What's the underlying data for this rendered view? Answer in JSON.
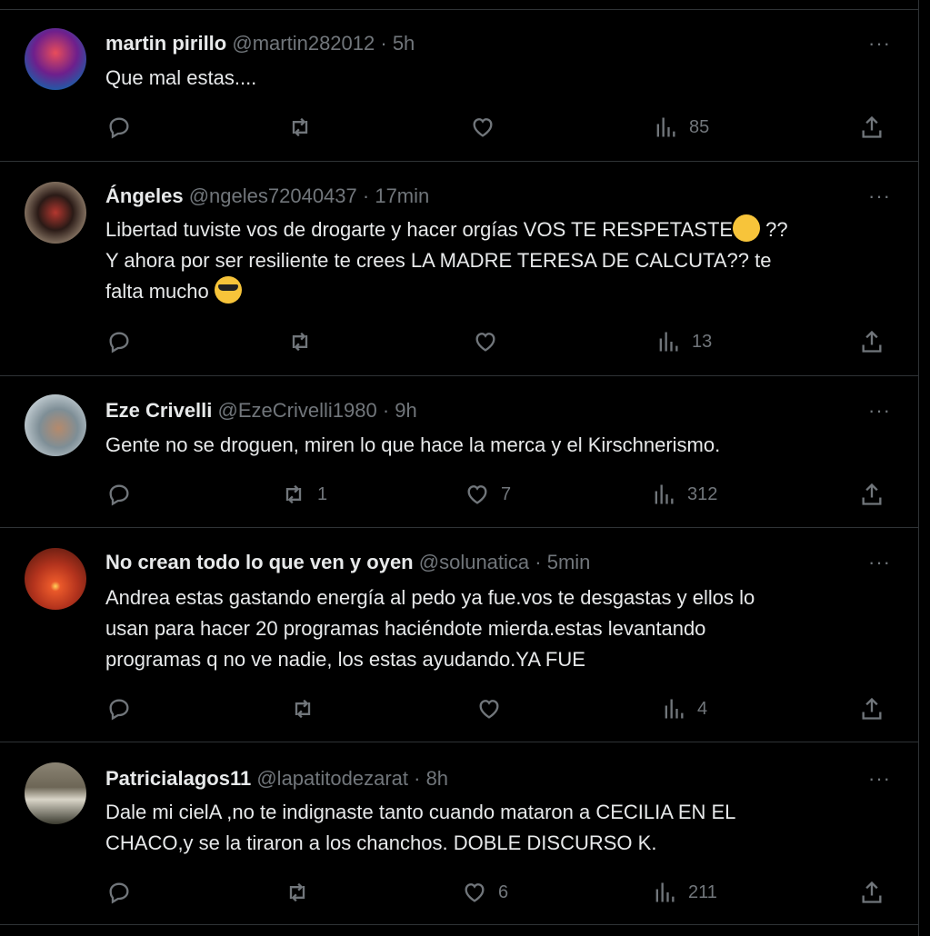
{
  "tweets": [
    {
      "name": "martin pirillo",
      "handle": "@martin282012",
      "time": "5h",
      "text": "Que mal estas....",
      "replies": "",
      "retweets": "",
      "likes": "",
      "views": "85",
      "more": "···"
    },
    {
      "name": "Ángeles",
      "handle": "@ngeles72040437",
      "time": "17min",
      "text_1": "Libertad tuviste vos de drogarte y hacer orgías VOS  TE RESPETASTE",
      "text_2": " ??",
      "text_3": "Y ahora por ser resiliente te crees LA MADRE TERESA DE CALCUTA?? te",
      "text_4": "falta mucho ",
      "emoji_1": "thinking-face-emoji",
      "emoji_2": "sunglasses-face-emoji",
      "replies": "",
      "retweets": "",
      "likes": "",
      "views": "13",
      "more": "···"
    },
    {
      "name": "Eze Crivelli",
      "handle": "@EzeCrivelli1980",
      "time": "9h",
      "text": "Gente no se droguen, miren lo que hace la merca y el Kirschnerismo.",
      "replies": "",
      "retweets": "1",
      "likes": "7",
      "views": "312",
      "more": "···"
    },
    {
      "name": "No crean todo lo que ven y oyen",
      "handle": "@solunatica",
      "time": "5min",
      "text_1": "Andrea estas gastando energía al pedo ya fue.vos te desgastas y ellos lo",
      "text_2": "usan para hacer 20 programas haciéndote mierda.estas levantando",
      "text_3": "programas q no ve nadie, los estas ayudando.YA FUE",
      "replies": "",
      "retweets": "",
      "likes": "",
      "views": "4",
      "more": "···"
    },
    {
      "name": "Patricialagos11",
      "handle": "@lapatitodezarat",
      "time": "8h",
      "text_1": "Dale  mi cielA ,no te indignaste tanto cuando mataron a CECILIA EN EL",
      "text_2": "CHACO,y se la tiraron a los chanchos. DOBLE DISCURSO K.",
      "replies": "",
      "retweets": "",
      "likes": "6",
      "views": "211",
      "more": "···"
    }
  ],
  "separator": " · ",
  "colors": {
    "background": "#000000",
    "text": "#e7e9ea",
    "muted": "#71767b",
    "border": "#2f3336"
  }
}
